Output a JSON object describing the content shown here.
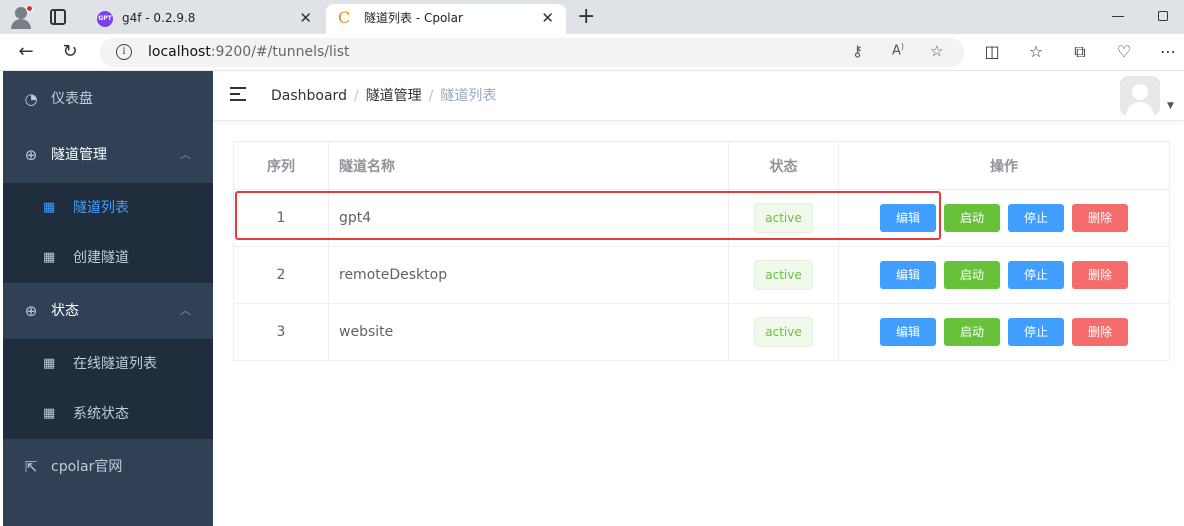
{
  "browser": {
    "tabs": [
      {
        "title": "g4f - 0.2.9.8",
        "favicon": "GPT"
      },
      {
        "title": "隧道列表 - Cpolar",
        "favicon": "C"
      }
    ],
    "url_host": "localhost",
    "url_path": ":9200/#/tunnels/list"
  },
  "sidebar": {
    "dashboard": "仪表盘",
    "tunnel_mgmt": "隧道管理",
    "tunnel_list": "隧道列表",
    "create_tunnel": "创建隧道",
    "status": "状态",
    "online_tunnels": "在线隧道列表",
    "system_status": "系统状态",
    "official_site": "cpolar官网"
  },
  "breadcrumb": [
    "Dashboard",
    "隧道管理",
    "隧道列表"
  ],
  "table": {
    "headers": [
      "序列",
      "隧道名称",
      "状态",
      "操作"
    ],
    "rows": [
      {
        "index": "1",
        "name": "gpt4",
        "status": "active"
      },
      {
        "index": "2",
        "name": "remoteDesktop",
        "status": "active"
      },
      {
        "index": "3",
        "name": "website",
        "status": "active"
      }
    ],
    "actions": {
      "edit": "编辑",
      "start": "启动",
      "stop": "停止",
      "delete": "删除"
    }
  },
  "colors": {
    "sidebar_bg": "#304156",
    "active_menu": "#409eff",
    "highlight": "#e83a3a"
  }
}
